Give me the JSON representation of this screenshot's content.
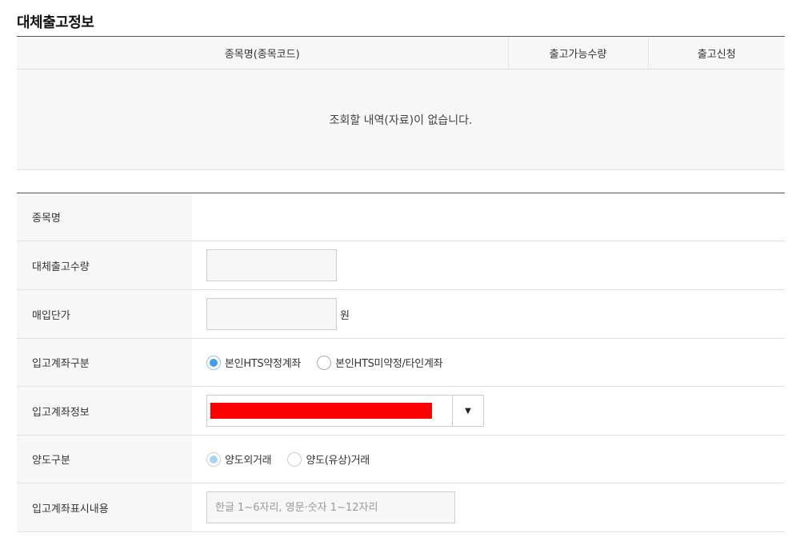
{
  "section_title": "대체출고정보",
  "list_table": {
    "headers": [
      "종목명(종목코드)",
      "출고가능수량",
      "출고신청"
    ],
    "empty_message": "조회할 내역(자료)이 없습니다."
  },
  "form": {
    "stock_name": {
      "label": "종목명",
      "value": ""
    },
    "quantity": {
      "label": "대체출고수량",
      "value": ""
    },
    "purchase_price": {
      "label": "매입단가",
      "value": "",
      "unit": "원"
    },
    "account_type": {
      "label": "입고계좌구분",
      "options": [
        "본인HTS약정계좌",
        "본인HTS미약정/타인계좌"
      ],
      "selected": "본인HTS약정계좌"
    },
    "account_info": {
      "label": "입고계좌정보",
      "arrow": "▼",
      "redacted_color": "#ff0000"
    },
    "transfer_type": {
      "label": "양도구분",
      "options": [
        "양도외거래",
        "양도(유상)거래"
      ],
      "selected": "양도외거래"
    },
    "display_text": {
      "label": "입고계좌표시내용",
      "placeholder": "한글 1~6자리, 영문·숫자 1~12자리",
      "value": ""
    }
  },
  "colors": {
    "accent_radio": "#3f9ee6",
    "redacted": "#ff0000",
    "header_bg": "#f7f7f7"
  }
}
